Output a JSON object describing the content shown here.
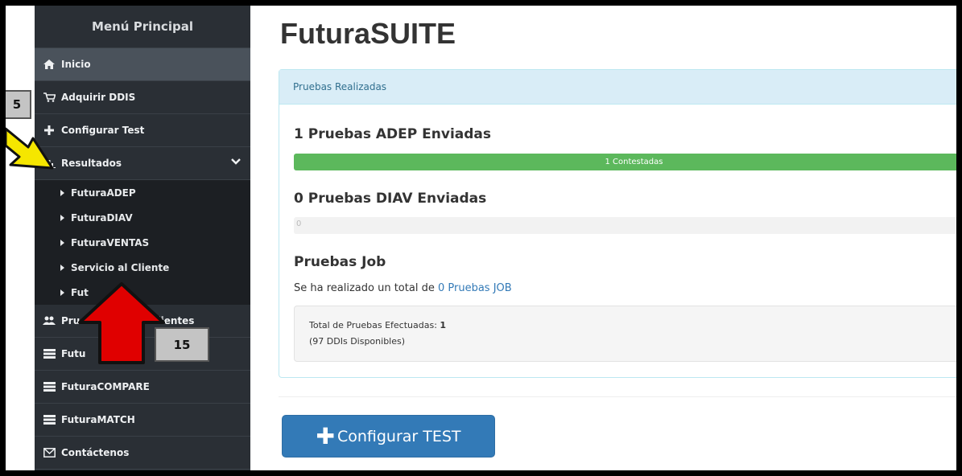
{
  "sidebar": {
    "header": "Menú Principal",
    "items": [
      {
        "label": "Inicio",
        "icon": "home-icon"
      },
      {
        "label": "Adquirir DDIS",
        "icon": "cart-icon"
      },
      {
        "label": "Configurar Test",
        "icon": "plus-icon"
      },
      {
        "label": "Resultados",
        "icon": "bar-chart-icon"
      }
    ],
    "submenu": [
      "FuturaADEP",
      "FuturaDIAV",
      "FuturaVENTAS",
      "Servicio al Cliente",
      "Fut"
    ],
    "items_after": [
      {
        "label": "Prue",
        "label_tail": "dientes",
        "icon": "users-icon"
      },
      {
        "label": "Futu",
        "icon": "server-icon"
      },
      {
        "label": "FuturaCOMPARE",
        "icon": "server-icon"
      },
      {
        "label": "FuturaMATCH",
        "icon": "server-icon"
      },
      {
        "label": "Contáctenos",
        "icon": "envelope-icon"
      }
    ]
  },
  "main": {
    "title": "FuturaSUITE",
    "panel_heading": "Pruebas Realizadas",
    "adep_title": "1 Pruebas ADEP Enviadas",
    "adep_progress_label": "1 Contestadas",
    "adep_progress": 1.0,
    "diav_title": "0 Pruebas DIAV Enviadas",
    "diav_progress_label": "0",
    "diav_progress": 0,
    "job_title": "Pruebas Job",
    "job_text_prefix": "Se ha realizado un total de",
    "job_link": "0 Pruebas JOB",
    "total_label": "Total de Pruebas Efectuadas:",
    "total_value": "1",
    "ddis_available": "(97 DDIs Disponibles)",
    "configure_button": "Configurar TEST"
  },
  "annotations": {
    "callout_left": "5",
    "callout_bottom": "15"
  },
  "colors": {
    "sidebar_bg": "#2a2f35",
    "submenu_bg": "#1c1f23",
    "progress_green": "#5cb85c",
    "button_blue": "#337ab7",
    "panel_heading_bg": "#d9edf7",
    "arrow_yellow": "#f5e600",
    "arrow_red": "#e00000"
  }
}
